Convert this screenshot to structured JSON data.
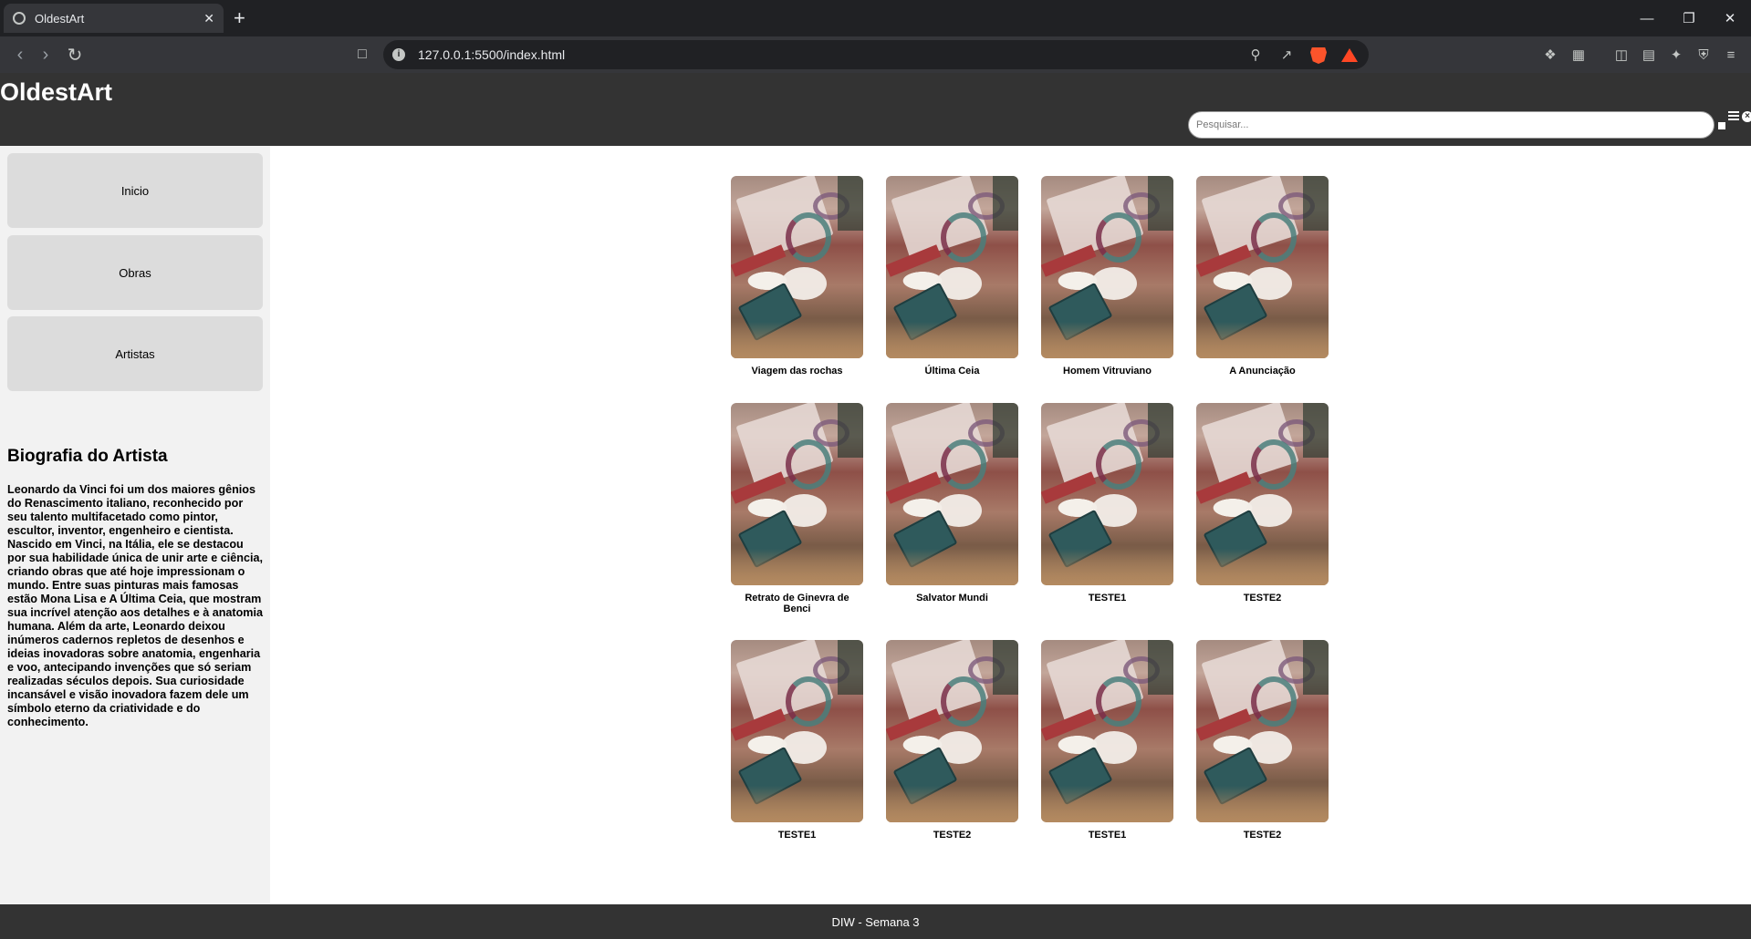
{
  "browser": {
    "tab_title": "OldestArt",
    "url": "127.0.0.1:5500/index.html",
    "new_tab": "+",
    "tab_close": "✕"
  },
  "header": {
    "logo": "OldestArt",
    "search_placeholder": "Pesquisar..."
  },
  "sidebar": {
    "nav": [
      {
        "label": "Inicio"
      },
      {
        "label": "Obras"
      },
      {
        "label": "Artistas"
      }
    ],
    "bio_title": "Biografia do Artista",
    "bio_text": "Leonardo da Vinci foi um dos maiores gênios do Renascimento italiano, reconhecido por seu talento multifacetado como pintor, escultor, inventor, engenheiro e cientista. Nascido em Vinci, na Itália, ele se destacou por sua habilidade única de unir arte e ciência, criando obras que até hoje impressionam o mundo. Entre suas pinturas mais famosas estão Mona Lisa e A Última Ceia, que mostram sua incrível atenção aos detalhes e à anatomia humana. Além da arte, Leonardo deixou inúmeros cadernos repletos de desenhos e ideias inovadoras sobre anatomia, engenharia e voo, antecipando invenções que só seriam realizadas séculos depois. Sua curiosidade incansável e visão inovadora fazem dele um símbolo eterno da criatividade e do conhecimento."
  },
  "gallery": [
    {
      "title": "Viagem das rochas"
    },
    {
      "title": "Última Ceia"
    },
    {
      "title": "Homem Vitruviano"
    },
    {
      "title": "A Anunciação"
    },
    {
      "title": "Retrato de Ginevra de Benci"
    },
    {
      "title": "Salvator Mundi"
    },
    {
      "title": "TESTE1"
    },
    {
      "title": "TESTE2"
    },
    {
      "title": "TESTE1"
    },
    {
      "title": "TESTE2"
    },
    {
      "title": "TESTE1"
    },
    {
      "title": "TESTE2"
    }
  ],
  "footer": {
    "text": "DIW - Semana 3"
  }
}
